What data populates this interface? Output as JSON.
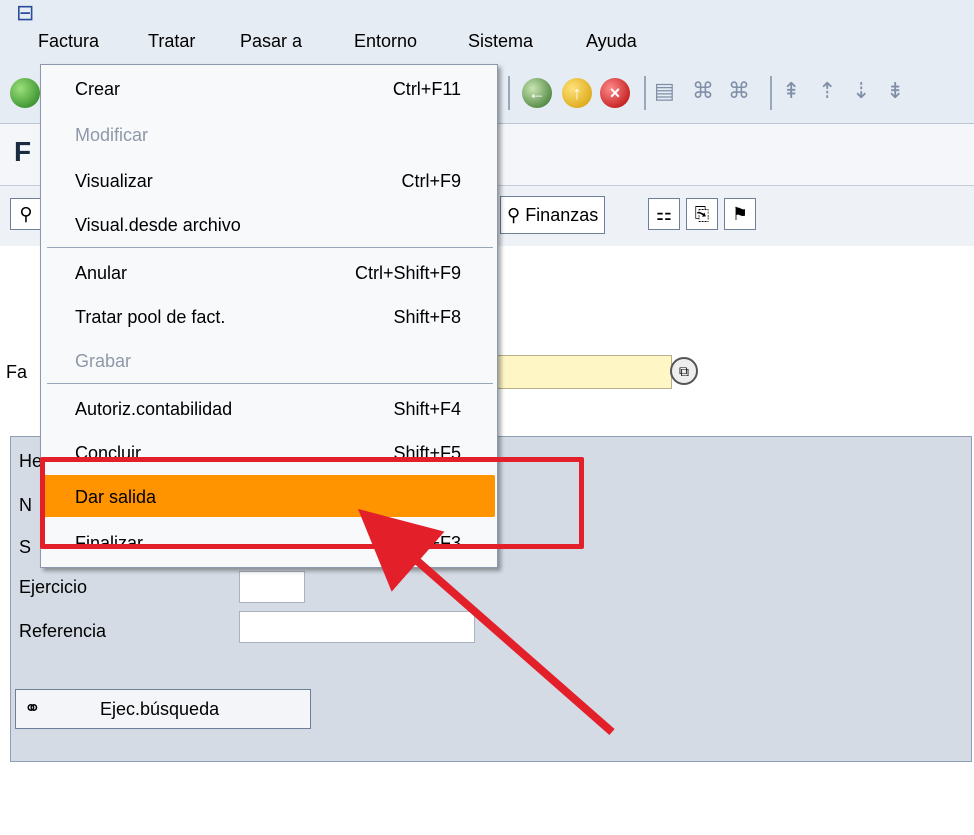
{
  "menubar": {
    "items": [
      {
        "label": "Factura"
      },
      {
        "label": "Tratar"
      },
      {
        "label": "Pasar a"
      },
      {
        "label": "Entorno"
      },
      {
        "label": "Sistema"
      },
      {
        "label": "Ayuda"
      }
    ]
  },
  "title": {
    "text": "F"
  },
  "app_toolbar": {
    "finanzas_label": "Finanzas"
  },
  "input_row": {
    "label": "Fa"
  },
  "group": {
    "header_fragment": "He",
    "rows": [
      {
        "label": "N"
      },
      {
        "label": "S"
      },
      {
        "label": "Ejercicio"
      },
      {
        "label": "Referencia"
      }
    ],
    "search_button": "Ejec.búsqueda"
  },
  "dropdown": {
    "items": [
      {
        "label": "Crear",
        "shortcut": "Ctrl+F11",
        "enabled": true
      },
      {
        "label": "Modificar",
        "shortcut": "",
        "enabled": false
      },
      {
        "label": "Visualizar",
        "shortcut": "Ctrl+F9",
        "enabled": true
      },
      {
        "label": "Visual.desde archivo",
        "shortcut": "",
        "enabled": true
      },
      {
        "label": "Anular",
        "shortcut": "Ctrl+Shift+F9",
        "enabled": true
      },
      {
        "label": "Tratar pool de fact.",
        "shortcut": "Shift+F8",
        "enabled": true
      },
      {
        "label": "Grabar",
        "shortcut": "",
        "enabled": false
      },
      {
        "label": "Autoriz.contabilidad",
        "shortcut": "Shift+F4",
        "enabled": true
      },
      {
        "label": "Concluir",
        "shortcut": "Shift+F5",
        "enabled": true
      },
      {
        "label": "Dar salida",
        "shortcut": "",
        "enabled": true,
        "highlighted": true
      },
      {
        "label": "Finalizar",
        "shortcut": "Shift+F3",
        "enabled": true
      }
    ]
  },
  "colors": {
    "menu_highlight": "#ff9300",
    "annotation_red": "#e3202a"
  }
}
